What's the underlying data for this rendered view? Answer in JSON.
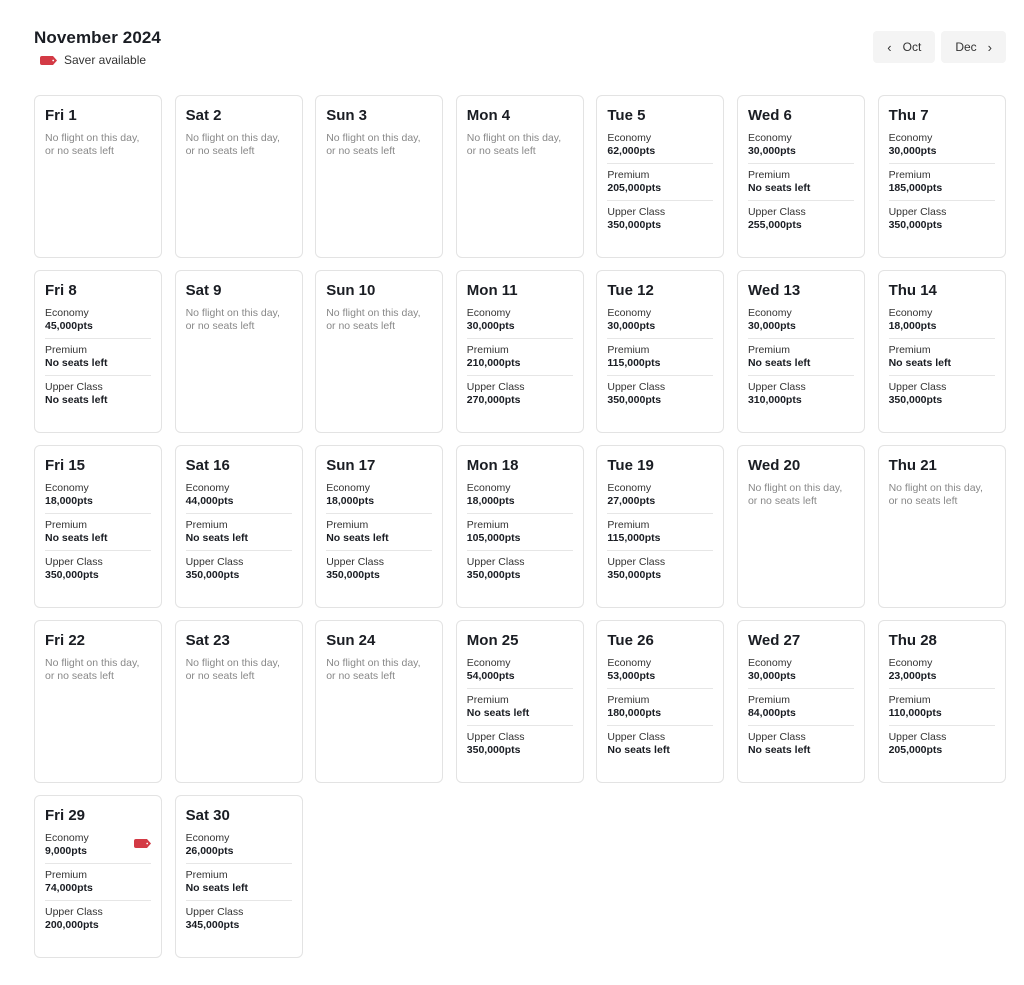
{
  "header": {
    "title": "November 2024",
    "legend_label": "Saver available",
    "saver_color": "#d33a45"
  },
  "nav": {
    "prev_label": "Oct",
    "next_label": "Dec",
    "prev_icon": "chevron-left-icon",
    "next_icon": "chevron-right-icon"
  },
  "labels": {
    "no_flight": "No flight on this day, or no seats left",
    "economy": "Economy",
    "premium": "Premium",
    "upper": "Upper Class"
  },
  "days": [
    {
      "label": "Fri 1",
      "available": false
    },
    {
      "label": "Sat 2",
      "available": false
    },
    {
      "label": "Sun 3",
      "available": false
    },
    {
      "label": "Mon 4",
      "available": false
    },
    {
      "label": "Tue 5",
      "available": true,
      "economy": "62,000pts",
      "premium": "205,000pts",
      "upper": "350,000pts"
    },
    {
      "label": "Wed 6",
      "available": true,
      "economy": "30,000pts",
      "premium": "No seats left",
      "upper": "255,000pts"
    },
    {
      "label": "Thu 7",
      "available": true,
      "economy": "30,000pts",
      "premium": "185,000pts",
      "upper": "350,000pts"
    },
    {
      "label": "Fri 8",
      "available": true,
      "economy": "45,000pts",
      "premium": "No seats left",
      "upper": "No seats left"
    },
    {
      "label": "Sat 9",
      "available": false
    },
    {
      "label": "Sun 10",
      "available": false
    },
    {
      "label": "Mon 11",
      "available": true,
      "economy": "30,000pts",
      "premium": "210,000pts",
      "upper": "270,000pts"
    },
    {
      "label": "Tue 12",
      "available": true,
      "economy": "30,000pts",
      "premium": "115,000pts",
      "upper": "350,000pts"
    },
    {
      "label": "Wed 13",
      "available": true,
      "economy": "30,000pts",
      "premium": "No seats left",
      "upper": "310,000pts"
    },
    {
      "label": "Thu 14",
      "available": true,
      "economy": "18,000pts",
      "premium": "No seats left",
      "upper": "350,000pts"
    },
    {
      "label": "Fri 15",
      "available": true,
      "economy": "18,000pts",
      "premium": "No seats left",
      "upper": "350,000pts"
    },
    {
      "label": "Sat 16",
      "available": true,
      "economy": "44,000pts",
      "premium": "No seats left",
      "upper": "350,000pts"
    },
    {
      "label": "Sun 17",
      "available": true,
      "economy": "18,000pts",
      "premium": "No seats left",
      "upper": "350,000pts"
    },
    {
      "label": "Mon 18",
      "available": true,
      "economy": "18,000pts",
      "premium": "105,000pts",
      "upper": "350,000pts"
    },
    {
      "label": "Tue 19",
      "available": true,
      "economy": "27,000pts",
      "premium": "115,000pts",
      "upper": "350,000pts"
    },
    {
      "label": "Wed 20",
      "available": false
    },
    {
      "label": "Thu 21",
      "available": false
    },
    {
      "label": "Fri 22",
      "available": false
    },
    {
      "label": "Sat 23",
      "available": false
    },
    {
      "label": "Sun 24",
      "available": false
    },
    {
      "label": "Mon 25",
      "available": true,
      "economy": "54,000pts",
      "premium": "No seats left",
      "upper": "350,000pts"
    },
    {
      "label": "Tue 26",
      "available": true,
      "economy": "53,000pts",
      "premium": "180,000pts",
      "upper": "No seats left"
    },
    {
      "label": "Wed 27",
      "available": true,
      "economy": "30,000pts",
      "premium": "84,000pts",
      "upper": "No seats left"
    },
    {
      "label": "Thu 28",
      "available": true,
      "economy": "23,000pts",
      "premium": "110,000pts",
      "upper": "205,000pts"
    },
    {
      "label": "Fri 29",
      "available": true,
      "economy": "9,000pts",
      "economy_saver": true,
      "premium": "74,000pts",
      "upper": "200,000pts"
    },
    {
      "label": "Sat 30",
      "available": true,
      "economy": "26,000pts",
      "premium": "No seats left",
      "upper": "345,000pts"
    }
  ]
}
